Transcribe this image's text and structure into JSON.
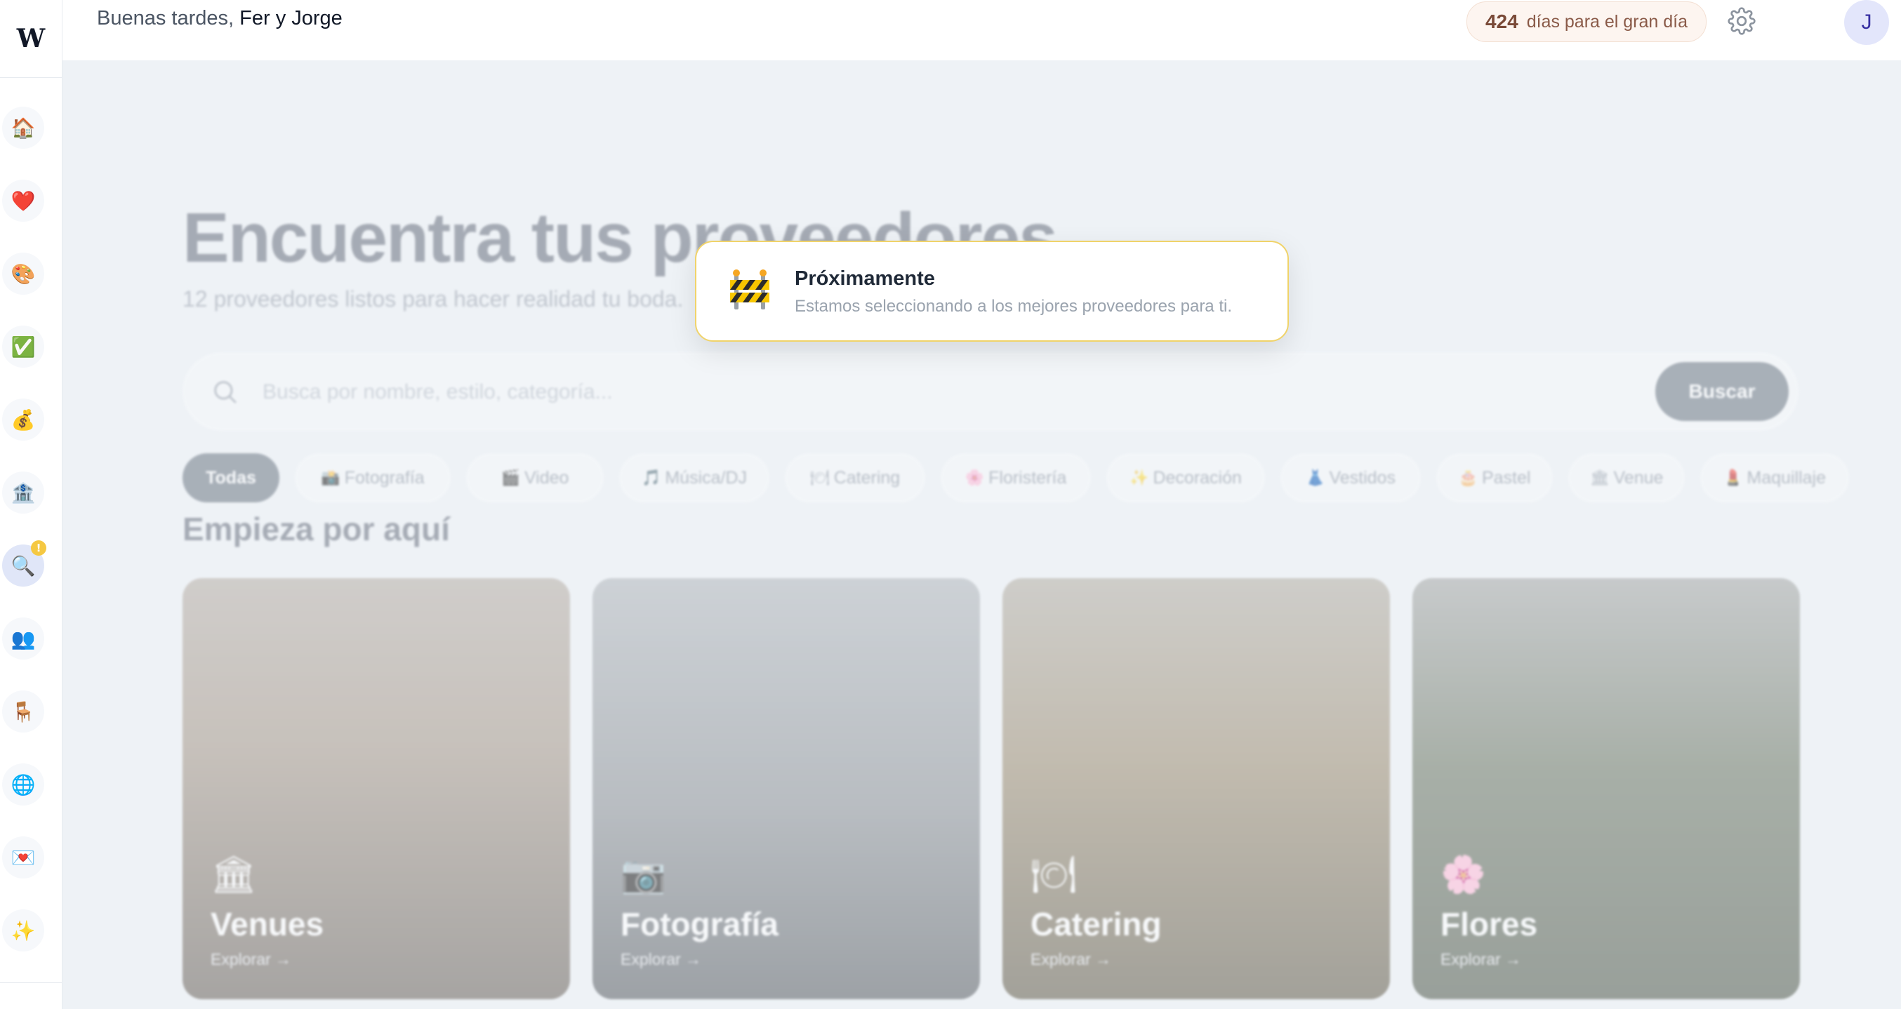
{
  "sidebar": {
    "logo": "W",
    "items": [
      {
        "icon": "house-icon",
        "glyph": "🏠"
      },
      {
        "icon": "heart-icon",
        "glyph": "❤️"
      },
      {
        "icon": "palette-icon",
        "glyph": "🎨"
      },
      {
        "icon": "checkmark-icon",
        "glyph": "✅"
      },
      {
        "icon": "money-bag-icon",
        "glyph": "💰"
      },
      {
        "icon": "bank-icon",
        "glyph": "🏦"
      },
      {
        "icon": "magnifier-icon",
        "glyph": "🔍",
        "badge": "!"
      },
      {
        "icon": "people-icon",
        "glyph": "👥"
      },
      {
        "icon": "chair-icon",
        "glyph": "🪑"
      },
      {
        "icon": "globe-icon",
        "glyph": "🌐"
      },
      {
        "icon": "love-letter-icon",
        "glyph": "💌"
      },
      {
        "icon": "sparkles-icon",
        "glyph": "✨"
      }
    ]
  },
  "header": {
    "greeting_prefix": "Buenas tardes,",
    "names": "Fer y Jorge",
    "countdown_number": "424",
    "countdown_text": "días para el gran día",
    "avatar_initial": "J"
  },
  "main": {
    "title": "Encuentra tus proveedores",
    "subtitle": "12 proveedores listos para hacer realidad tu boda.",
    "search_placeholder": "Busca por nombre, estilo, categoría...",
    "search_button": "Buscar",
    "chips": [
      {
        "emoji": "",
        "label": "Todas"
      },
      {
        "emoji": "📸",
        "label": "Fotografía"
      },
      {
        "emoji": "🎬",
        "label": "Video"
      },
      {
        "emoji": "🎵",
        "label": "Música/DJ"
      },
      {
        "emoji": "🍽",
        "label": "Catering"
      },
      {
        "emoji": "🌸",
        "label": "Floristería"
      },
      {
        "emoji": "✨",
        "label": "Decoración"
      },
      {
        "emoji": "👗",
        "label": "Vestidos"
      },
      {
        "emoji": "🎂",
        "label": "Pastel"
      },
      {
        "emoji": "🏛",
        "label": "Venue"
      },
      {
        "emoji": "💄",
        "label": "Maquillaje"
      }
    ],
    "section_title": "Empieza por aquí",
    "cards": [
      {
        "icon": "🏛",
        "title": "Venues",
        "link": "Explorar →"
      },
      {
        "icon": "📷",
        "title": "Fotografía",
        "link": "Explorar →"
      },
      {
        "icon": "🍽",
        "title": "Catering",
        "link": "Explorar →"
      },
      {
        "icon": "🌸",
        "title": "Flores",
        "link": "Explorar →"
      }
    ]
  },
  "toast": {
    "title": "Próximamente",
    "message": "Estamos seleccionando a los mejores proveedores para ti."
  }
}
